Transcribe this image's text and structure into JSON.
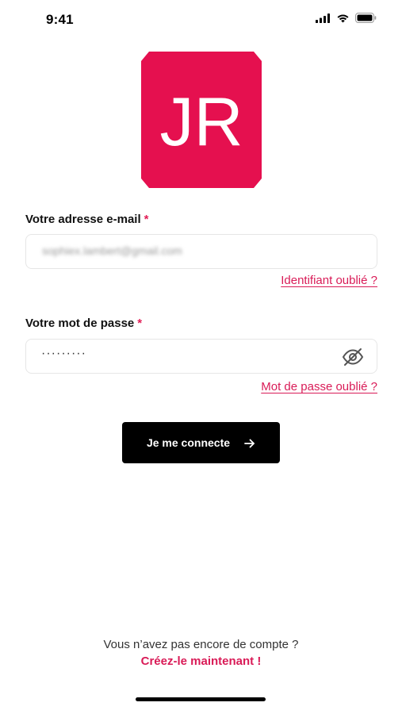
{
  "status_bar": {
    "time": "9:41",
    "icons": [
      "signal-icon",
      "wifi-icon",
      "battery-icon"
    ]
  },
  "logo": {
    "text": "JR",
    "color": "#e5104f"
  },
  "form": {
    "email_label": "Votre adresse e-mail",
    "email_required": "*",
    "email_value": "sophiex.lambert@gmail.com",
    "forgot_id_link": "Identifiant oublié ?",
    "password_label": "Votre mot de passe",
    "password_required": "*",
    "password_value": "·········",
    "password_toggle_icon": "eye-slash-icon",
    "forgot_password_link": "Mot de passe oublié ?",
    "submit_label": "Je me connecte",
    "submit_icon": "arrow-right-icon"
  },
  "footer": {
    "prompt": "Vous n’avez pas encore de compte ?",
    "create_link": "Créez-le maintenant !"
  },
  "colors": {
    "accent": "#d91b57",
    "button": "#000000"
  }
}
